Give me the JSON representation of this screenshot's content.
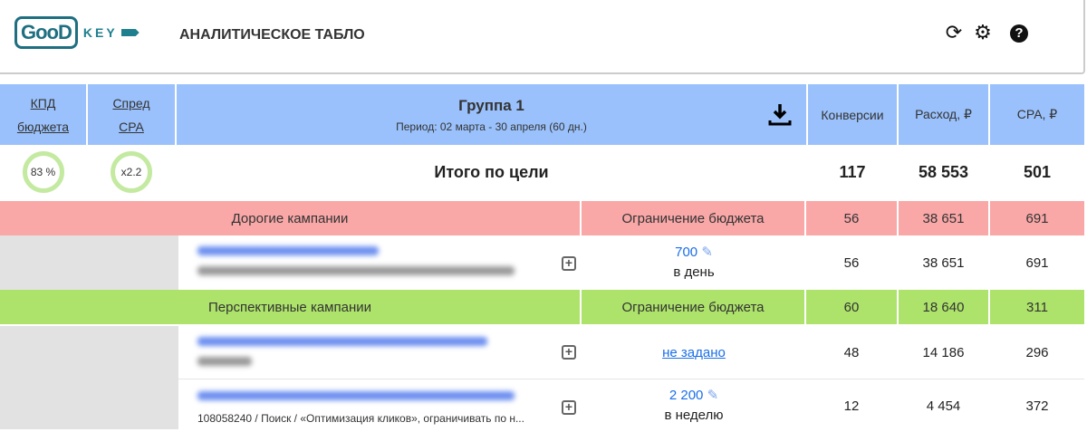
{
  "header": {
    "logo_text": "GooD KEY",
    "title": "АНАЛИТИЧЕСКОЕ ТАБЛО"
  },
  "table": {
    "col_kpd": [
      "КПД",
      "бюджета"
    ],
    "col_spread": [
      "Спред",
      "CPA"
    ],
    "group_title": "Группа 1",
    "period": "Период: 02 марта - 30 апреля (60 дн.)",
    "col_conv": "Конверсии",
    "col_spend": "Расход, ₽",
    "col_cpa": "CPA, ₽",
    "kpd_value": "83 %",
    "spread_value": "x2.2",
    "total": {
      "label": "Итого по цели",
      "conv": "117",
      "spend": "58 553",
      "cpa": "501"
    },
    "groups": [
      {
        "label": "Дорогие кампании",
        "reason": "Ограничение бюджета",
        "conv": "56",
        "spend": "38 651",
        "cpa": "691",
        "rows": [
          {
            "budget": "700",
            "period": "в день",
            "conv": "56",
            "spend": "38 651",
            "cpa": "691"
          }
        ]
      },
      {
        "label": "Перспективные кампании",
        "reason": "Ограничение бюджета",
        "conv": "60",
        "spend": "18 640",
        "cpa": "311",
        "rows": [
          {
            "budget": "не задано",
            "conv": "48",
            "spend": "14 186",
            "cpa": "296"
          },
          {
            "desc": "108058240 / Поиск / «Оптимизация кликов», ограничивать по н...",
            "budget": "2 200",
            "period": "в неделю",
            "conv": "12",
            "spend": "4 454",
            "cpa": "372"
          }
        ]
      }
    ]
  }
}
